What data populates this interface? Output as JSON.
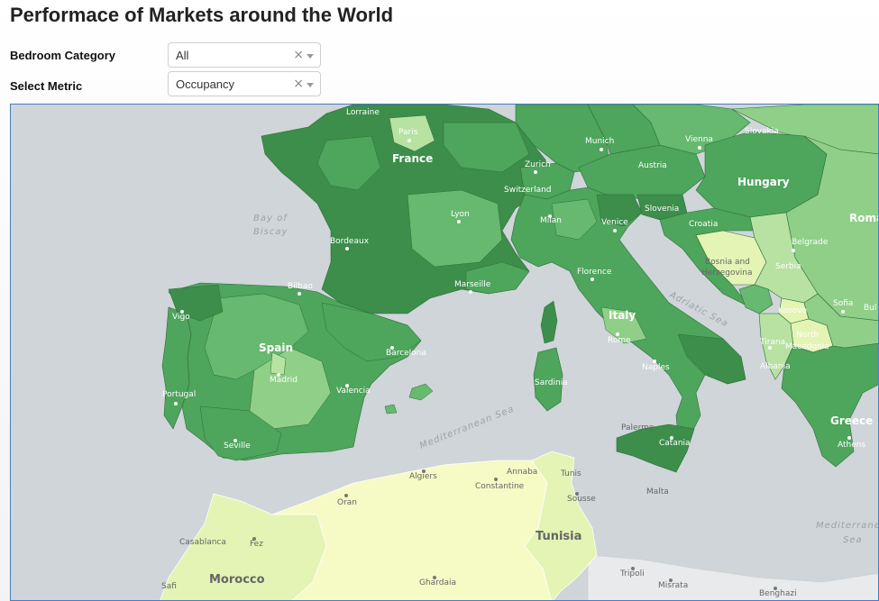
{
  "title": "Performace of Markets around the World",
  "filters": {
    "bedroom": {
      "label": "Bedroom Category",
      "value": "All"
    },
    "metric": {
      "label": "Select Metric",
      "value": "Occupancy"
    }
  },
  "clear_glyph": "×",
  "map": {
    "countries": {
      "france": "France",
      "spain": "Spain",
      "portugal": "Portugal",
      "italy": "Italy",
      "switzerland": "Switzerland",
      "austria": "Austria",
      "hungary": "Hungary",
      "slovakia": "Slovakia",
      "slovenia": "Slovenia",
      "croatia": "Croatia",
      "bosnia_1": "Bosnia and",
      "bosnia_2": "Herzegovina",
      "serbia": "Serbia",
      "kosovo": "Kosovo",
      "north_macedonia_1": "North",
      "north_macedonia_2": "Macedonia",
      "albania": "Albania",
      "greece": "Greece",
      "romania": "Roma",
      "bulgaria": "Bul",
      "morocco": "Morocco",
      "tunisia": "Tunisia",
      "malta": "Malta"
    },
    "cities": {
      "paris": "Paris",
      "munich": "Munich",
      "vienna": "Vienna",
      "zurich": "Zurich",
      "lyon": "Lyon",
      "milan": "Milan",
      "venice": "Venice",
      "bordeaux": "Bordeaux",
      "marseille": "Marseille",
      "florence": "Florence",
      "rome": "Rome",
      "naples": "Naples",
      "bilbao": "Bilbao",
      "vigo": "Vigo",
      "madrid": "Madrid",
      "barcelona": "Barcelona",
      "valencia": "Valencia",
      "seville": "Seville",
      "palermo": "Palermo",
      "catania": "Catania",
      "belgrade": "Belgrade",
      "sofia": "Sofia",
      "tirana": "Tirana",
      "athens": "Athens",
      "algiers": "Algiers",
      "annaba": "Annaba",
      "constantine": "Constantine",
      "oran": "Oran",
      "tunis": "Tunis",
      "sousse": "Sousse",
      "casablanca": "Casablanca",
      "fez": "Fez",
      "tripoli": "Tripoli",
      "misrata": "Misrata",
      "benghazi": "Benghazi",
      "ghardaia": "Ghardaia",
      "lorraine": "Lorraine",
      "safi": "Safi",
      "sardinia": "Sardinia"
    },
    "seas": {
      "biscay_1": "Bay of",
      "biscay_2": "Biscay",
      "adriatic": "Adriatic Sea",
      "mediterranean": "Mediterranean Sea",
      "med_east_1": "Mediterranea",
      "med_east_2": "Sea"
    },
    "colors": {
      "water": "#cfd5d8",
      "nodata": "#e8eaeb",
      "darkest": "#3c8e4a",
      "dark": "#4ea55c",
      "mid": "#66b96f",
      "light": "#8fcf88",
      "lighter": "#b7e2a2",
      "pale": "#e3f4b4",
      "palest": "#f6fac4"
    }
  }
}
